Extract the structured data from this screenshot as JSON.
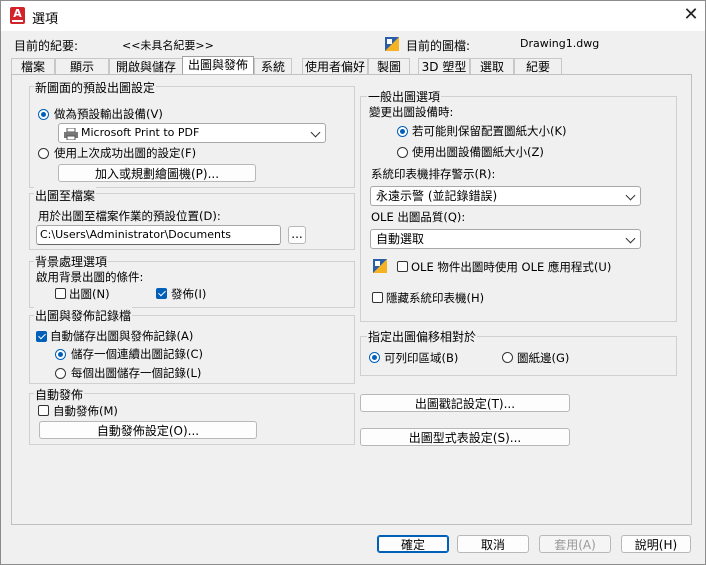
{
  "window": {
    "title": "選項",
    "close_label": "✕"
  },
  "header": {
    "current_profile_label": "目前的紀要:",
    "current_profile_value": "<<未具名紀要>>",
    "current_drawing_label": "目前的圖檔:",
    "current_drawing_value": "Drawing1.dwg"
  },
  "tabs": [
    "檔案",
    "顯示",
    "開啟與儲存",
    "出圖與發佈",
    "系統",
    "使用者偏好",
    "製圖",
    "3D 塑型",
    "選取",
    "紀要"
  ],
  "active_tab": "出圖與發佈",
  "default_output": {
    "title": "新圖面的預設出圖設定",
    "use_default_device_label": "做為預設輸出設備(V)",
    "device_value": "Microsoft Print to PDF",
    "use_last_label": "使用上次成功出圖的設定(F)",
    "add_plotter_button": "加入或規劃繪圖機(P)..."
  },
  "plot_to_file": {
    "title": "出圖至檔案",
    "location_label": "用於出圖至檔案作業的預設位置(D):",
    "location_value": "C:\\Users\\Administrator\\Documents",
    "browse_button": "..."
  },
  "background": {
    "title": "背景處理選項",
    "enable_label": "啟用背景出圖的條件:",
    "plot_label": "出圖(N)",
    "publish_label": "發佈(I)"
  },
  "log": {
    "title": "出圖與發佈記錄檔",
    "auto_save_label": "自動儲存出圖與發佈記錄(A)",
    "single_log_label": "儲存一個連續出圖記錄(C)",
    "per_plot_label": "每個出圖儲存一個記錄(L)"
  },
  "auto_publish": {
    "title": "自動發佈",
    "checkbox_label": "自動發佈(M)",
    "settings_button": "自動發佈設定(O)..."
  },
  "general": {
    "title": "一般出圖選項",
    "change_device_label": "變更出圖設備時:",
    "keep_paper_label": "若可能則保留配置圖紙大小(K)",
    "use_device_paper_label": "使用出圖設備圖紙大小(Z)",
    "spooler_label": "系統印表機排存警示(R):",
    "spooler_value": "永遠示警 (並記錄錯誤)",
    "ole_quality_label": "OLE 出圖品質(Q):",
    "ole_quality_value": "自動選取",
    "ole_app_label": "OLE 物件出圖時使用 OLE 應用程式(U)",
    "hide_printers_label": "隱藏系統印表機(H)"
  },
  "offset": {
    "title": "指定出圖偏移相對於",
    "printable_label": "可列印區域(B)",
    "paper_edge_label": "圖紙邊(G)"
  },
  "buttons": {
    "plot_stamp": "出圖戳記設定(T)...",
    "plot_style": "出圖型式表設定(S)...",
    "ok": "確定",
    "cancel": "取消",
    "apply": "套用(A)",
    "help": "說明(H)"
  },
  "colors": {
    "accent": "#005fb8",
    "brand": "#d2232a"
  }
}
